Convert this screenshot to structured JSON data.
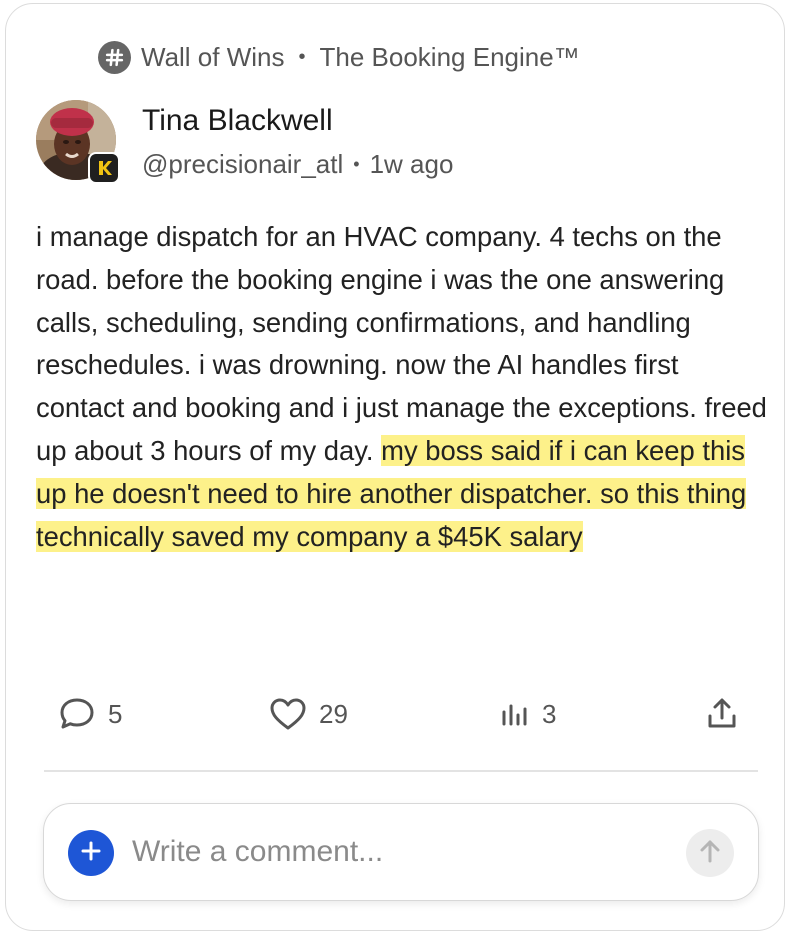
{
  "channel": {
    "icon": "hashtag-icon",
    "name": "Wall of Wins",
    "separator": "•",
    "space": "The Booking Engine™"
  },
  "author": {
    "name": "Tina Blackwell",
    "handle": "@precisionair_atl",
    "separator": "•",
    "time": "1w ago",
    "badge_icon": "k-logo-badge-icon"
  },
  "post": {
    "text": "i manage dispatch for an HVAC company. 4 techs on the road. before the booking engine i was the one answering calls, scheduling, sending confirmations, and handling reschedules. i was drowning. now the AI handles first contact and booking and i just manage the exceptions. freed up about 3 hours of my day. ",
    "highlight": "my boss said if i can keep this up he doesn't need to hire another dispatcher. so this thing technically saved my company a $45K salary",
    "highlight_color": "#fdf18a"
  },
  "actions": {
    "comments": {
      "icon": "comment-bubble-icon",
      "count": "5"
    },
    "likes": {
      "icon": "heart-icon",
      "count": "29"
    },
    "views": {
      "icon": "bar-chart-icon",
      "count": "3"
    },
    "share": {
      "icon": "share-upload-icon"
    }
  },
  "composer": {
    "placeholder": "Write a comment...",
    "add_icon": "plus-icon",
    "send_icon": "arrow-up-icon",
    "accent": "#1e56d6"
  }
}
